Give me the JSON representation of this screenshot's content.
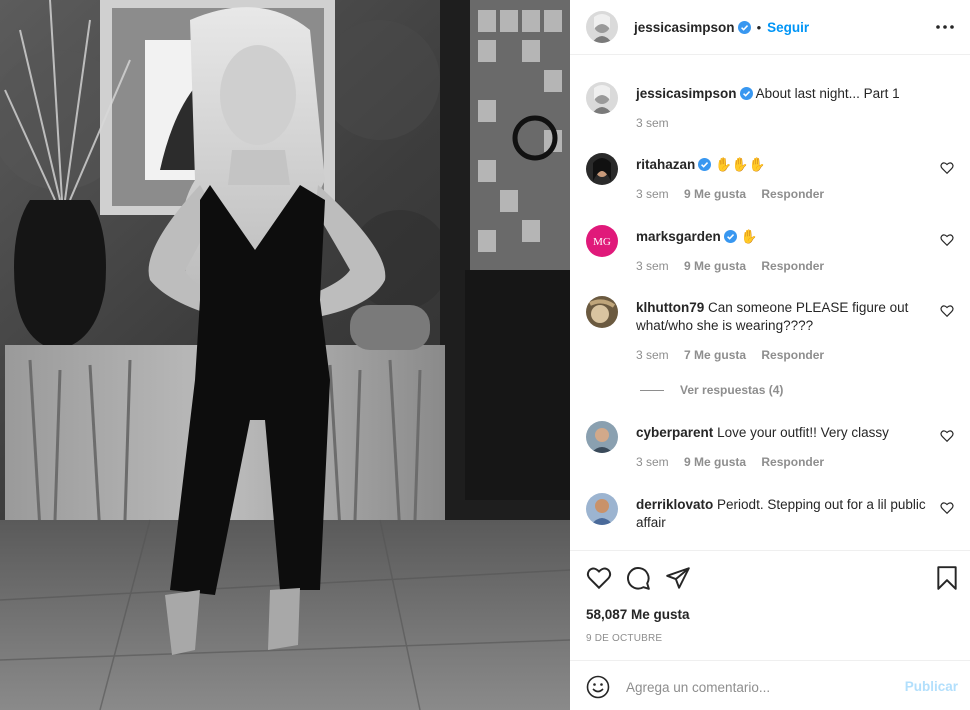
{
  "colors": {
    "link_blue": "#0095f6",
    "publish_disabled": "#b2dffc",
    "muted": "#8e8e8e",
    "text": "#262626"
  },
  "post": {
    "author": "jessicasimpson",
    "follow_label": "Seguir",
    "separator": "•",
    "more_icon": "more-horizontal-icon"
  },
  "caption": {
    "username": "jessicasimpson",
    "text": "About last night... Part 1",
    "time": "3 sem"
  },
  "comments": [
    {
      "username": "ritahazan",
      "verified": true,
      "text": "✋✋✋",
      "time": "3 sem",
      "likes": "9 Me gusta",
      "reply": "Responder"
    },
    {
      "username": "marksgarden",
      "verified": true,
      "text": "✋",
      "time": "3 sem",
      "likes": "9 Me gusta",
      "reply": "Responder"
    },
    {
      "username": "klhutton79",
      "verified": false,
      "text": "Can someone PLEASE figure out what/who she is wearing????",
      "time": "3 sem",
      "likes": "7 Me gusta",
      "reply": "Responder"
    },
    {
      "username": "cyberparent",
      "verified": false,
      "text": "Love your outfit!! Very classy",
      "time": "3 sem",
      "likes": "9 Me gusta",
      "reply": "Responder"
    },
    {
      "username": "derriklovato",
      "verified": false,
      "text": "Periodt. Stepping out for a lil public affair",
      "time": "",
      "likes": "",
      "reply": ""
    }
  ],
  "view_replies": "Ver respuestas (4)",
  "avatar_marks": {
    "marksgarden": "MG"
  },
  "actions": {
    "icons": [
      "heart-icon",
      "comment-icon",
      "share-icon",
      "bookmark-icon"
    ],
    "likes": "58,087 Me gusta",
    "date": "9 DE OCTUBRE"
  },
  "add_comment": {
    "placeholder": "Agrega un comentario...",
    "publish_label": "Publicar",
    "emoji_icon": "emoji-icon"
  }
}
